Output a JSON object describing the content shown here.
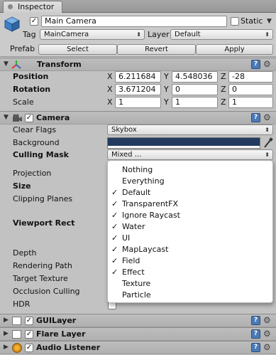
{
  "window": {
    "tab_label": "Inspector"
  },
  "header": {
    "object_name": "Main Camera",
    "static_label": "Static",
    "tag_label": "Tag",
    "tag_value": "MainCamera",
    "layer_label": "Layer",
    "layer_value": "Default",
    "prefab_label": "Prefab",
    "prefab_buttons": [
      "Select",
      "Revert",
      "Apply"
    ]
  },
  "transform": {
    "title": "Transform",
    "rows": [
      {
        "label": "Position",
        "x": "6.211684",
        "y": "4.548036",
        "z": "-28"
      },
      {
        "label": "Rotation",
        "x": "3.671204",
        "y": "0",
        "z": "0"
      },
      {
        "label": "Scale",
        "x": "1",
        "y": "1",
        "z": "1"
      }
    ],
    "axis_labels": [
      "X",
      "Y",
      "Z"
    ]
  },
  "camera": {
    "title": "Camera",
    "clear_flags_label": "Clear Flags",
    "clear_flags_value": "Skybox",
    "background_label": "Background",
    "background_color": "#233a5e",
    "culling_mask_label": "Culling Mask",
    "culling_mask_value": "Mixed ...",
    "other_labels": [
      "Projection",
      "Size",
      "Clipping Planes",
      "Viewport Rect",
      "Depth",
      "Rendering Path",
      "Target Texture",
      "Occlusion Culling",
      "HDR"
    ]
  },
  "culling_menu": {
    "items": [
      {
        "label": "Nothing",
        "checked": false
      },
      {
        "label": "Everything",
        "checked": false
      },
      {
        "label": "Default",
        "checked": true
      },
      {
        "label": "TransparentFX",
        "checked": true
      },
      {
        "label": "Ignore Raycast",
        "checked": true
      },
      {
        "label": "Water",
        "checked": true
      },
      {
        "label": "UI",
        "checked": true
      },
      {
        "label": "MapLaycast",
        "checked": true
      },
      {
        "label": "Field",
        "checked": true
      },
      {
        "label": "Effect",
        "checked": true
      },
      {
        "label": "Texture",
        "checked": false
      },
      {
        "label": "Particle",
        "checked": false
      }
    ]
  },
  "components": [
    {
      "title": "GUILayer"
    },
    {
      "title": "Flare Layer"
    },
    {
      "title": "Audio Listener"
    }
  ],
  "icons": {
    "help": "?",
    "settings": "⚙",
    "check": "✓",
    "expand": "▼",
    "collapse": "▶"
  }
}
